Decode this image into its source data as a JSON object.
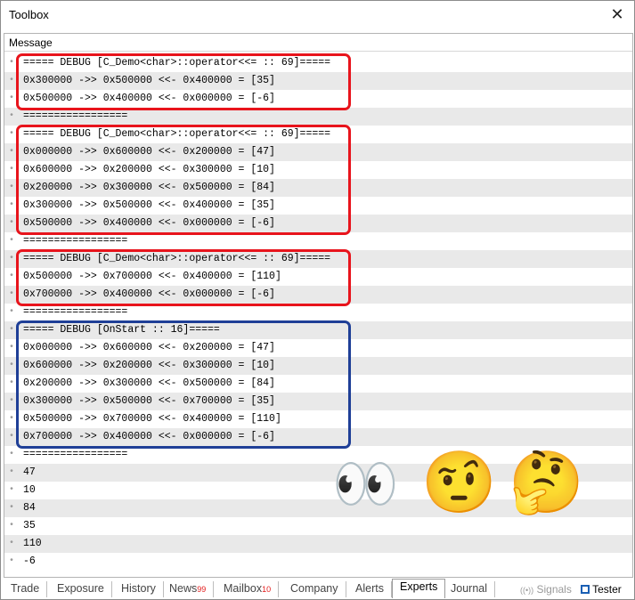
{
  "window": {
    "title": "Toolbox",
    "close_glyph": "✕"
  },
  "column_header": "Message",
  "rows": [
    "===== DEBUG [C_Demo<char>::operator<<= :: 69]=====",
    "0x300000 ->> 0x500000 <<- 0x400000 = [35]",
    "0x500000 ->> 0x400000 <<- 0x000000 = [-6]",
    "=================",
    "===== DEBUG [C_Demo<char>::operator<<= :: 69]=====",
    "0x000000 ->> 0x600000 <<- 0x200000 = [47]",
    "0x600000 ->> 0x200000 <<- 0x300000 = [10]",
    "0x200000 ->> 0x300000 <<- 0x500000 = [84]",
    "0x300000 ->> 0x500000 <<- 0x400000 = [35]",
    "0x500000 ->> 0x400000 <<- 0x000000 = [-6]",
    "=================",
    "===== DEBUG [C_Demo<char>::operator<<= :: 69]=====",
    "0x500000 ->> 0x700000 <<- 0x400000 = [110]",
    "0x700000 ->> 0x400000 <<- 0x000000 = [-6]",
    "=================",
    "===== DEBUG [OnStart :: 16]=====",
    "0x000000 ->> 0x600000 <<- 0x200000 = [47]",
    "0x600000 ->> 0x200000 <<- 0x300000 = [10]",
    "0x200000 ->> 0x300000 <<- 0x500000 = [84]",
    "0x300000 ->> 0x500000 <<- 0x700000 = [35]",
    "0x500000 ->> 0x700000 <<- 0x400000 = [110]",
    "0x700000 ->> 0x400000 <<- 0x000000 = [-6]",
    "=================",
    "47",
    "10",
    "84",
    "35",
    "110",
    "-6"
  ],
  "emoji": {
    "eyes": "👀",
    "raised_eyebrow": "🤨",
    "thinking": "🤔"
  },
  "highlight_colors": {
    "red": "#e8141c",
    "blue": "#1f3f97"
  },
  "tabs": [
    {
      "label": "Trade"
    },
    {
      "label": "Exposure"
    },
    {
      "label": "History"
    },
    {
      "label": "News",
      "badge": "99"
    },
    {
      "label": "Mailbox",
      "badge": "10"
    },
    {
      "label": "Company"
    },
    {
      "label": "Alerts"
    },
    {
      "label": "Experts",
      "active": true
    },
    {
      "label": "Journal"
    }
  ],
  "status": {
    "signals_icon": "((•))",
    "signals_label": "Signals",
    "tester_label": "Tester",
    "tester_icon": "chip-icon"
  }
}
